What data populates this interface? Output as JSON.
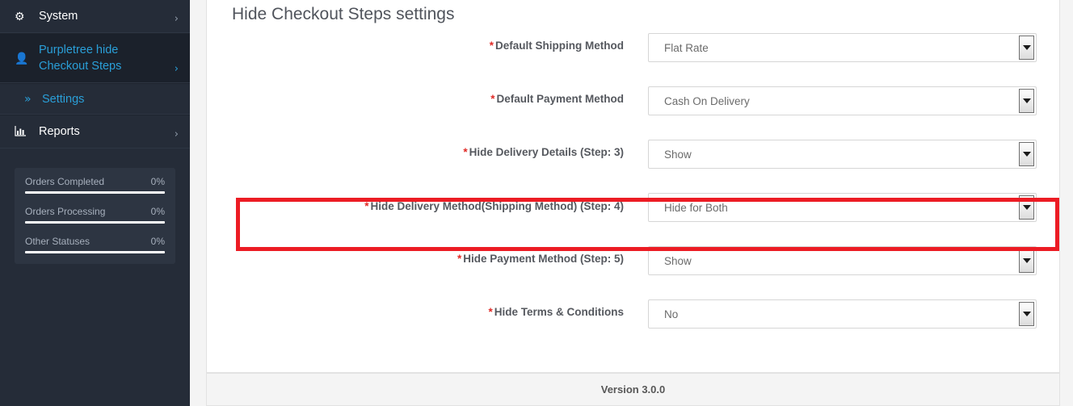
{
  "sidebar": {
    "nav_items": [
      {
        "label": "System",
        "icon": "gear-icon",
        "glyph": "⚙",
        "arrow": "›",
        "active": false
      },
      {
        "label": "Purpletree hide Checkout Steps",
        "icon": "user-icon",
        "glyph": "👤",
        "arrow": "›",
        "active": true
      }
    ],
    "sub_item": {
      "label": "Settings",
      "icon": "double-chevron-right-icon",
      "glyph": "»"
    },
    "reports_item": {
      "label": "Reports",
      "icon": "bar-chart-icon",
      "glyph": "📊",
      "arrow": "›"
    },
    "stats": [
      {
        "name": "Orders Completed",
        "percent": "0%",
        "value": 0
      },
      {
        "name": "Orders Processing",
        "percent": "0%",
        "value": 0
      },
      {
        "name": "Other Statuses",
        "percent": "0%",
        "value": 0
      }
    ]
  },
  "main": {
    "title": "Hide Checkout Steps settings",
    "required_marker": "*",
    "fields": [
      {
        "label": "Default Shipping Method",
        "value": "Flat Rate",
        "required": true,
        "highlighted": false
      },
      {
        "label": "Default Payment Method",
        "value": "Cash On Delivery",
        "required": true,
        "highlighted": false
      },
      {
        "label": "Hide Delivery Details (Step: 3)",
        "value": "Show",
        "required": true,
        "highlighted": false
      },
      {
        "label": "Hide Delivery Method(Shipping Method) (Step: 4)",
        "value": "Hide for Both",
        "required": true,
        "highlighted": true
      },
      {
        "label": "Hide Payment Method (Step: 5)",
        "value": "Show",
        "required": true,
        "highlighted": false
      },
      {
        "label": "Hide Terms & Conditions",
        "value": "No",
        "required": true,
        "highlighted": false
      }
    ],
    "footer_text": "Version 3.0.0"
  },
  "colors": {
    "sidebar_bg": "#252c38",
    "sidebar_active_bg": "#1b212b",
    "accent_blue": "#2a9fd8",
    "required_red": "#e02b27",
    "highlight_red": "#ec1c24",
    "panel_bg": "#ffffff",
    "page_bg": "#f4f4f4"
  }
}
